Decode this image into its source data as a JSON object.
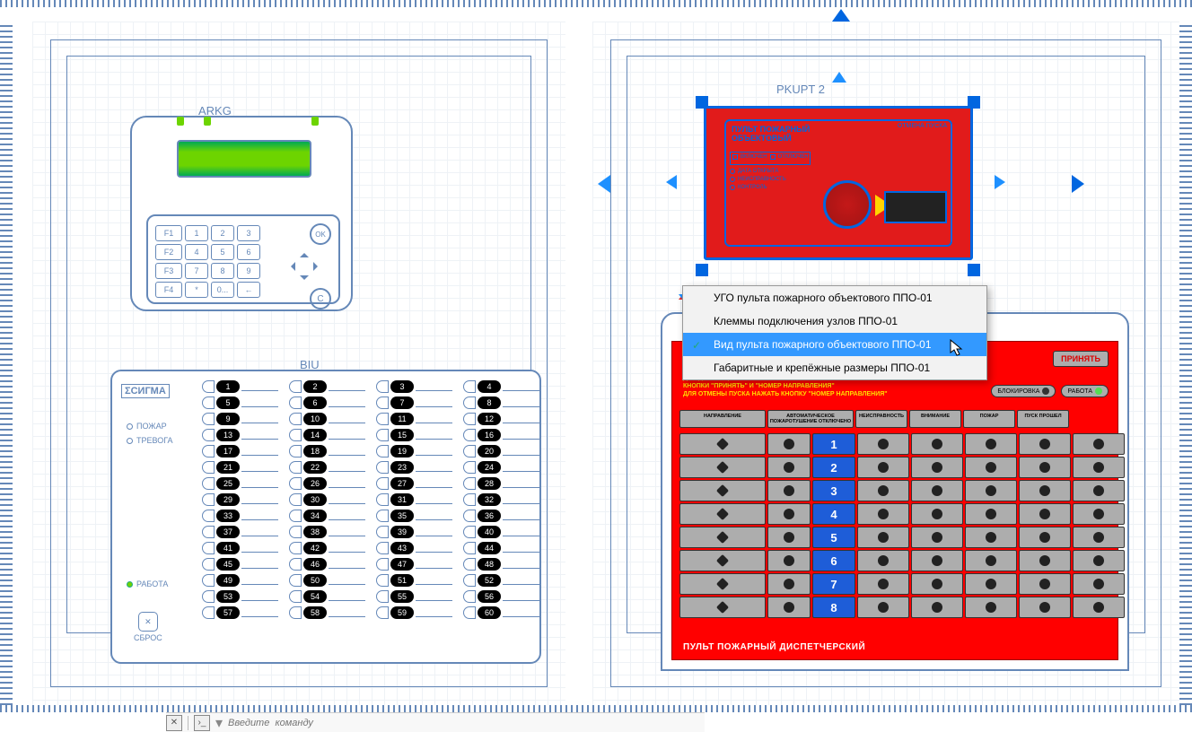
{
  "left_page": {
    "arkg": {
      "label": "ARKG",
      "function_keys": [
        "F1",
        "F2",
        "F3",
        "F4"
      ],
      "numpad": [
        [
          "1",
          "2",
          "3"
        ],
        [
          "4",
          "5",
          "6"
        ],
        [
          "7",
          "8",
          "9"
        ],
        [
          "*",
          "0...",
          "←"
        ]
      ],
      "ok": "OK",
      "c": "C"
    },
    "biu": {
      "label": "BIU",
      "brand": "ΣСИГМА",
      "status": {
        "fire": "ПОЖАР",
        "alarm": "ТРЕВОГА",
        "work": "РАБОТА"
      },
      "reset": "СБРОС",
      "zones": [
        "1",
        "2",
        "3",
        "4",
        "5",
        "6",
        "7",
        "8",
        "9",
        "10",
        "11",
        "12",
        "13",
        "14",
        "15",
        "16",
        "17",
        "18",
        "19",
        "20",
        "21",
        "22",
        "23",
        "24",
        "25",
        "26",
        "27",
        "28",
        "29",
        "30",
        "31",
        "32",
        "33",
        "34",
        "35",
        "36",
        "37",
        "38",
        "39",
        "40",
        "41",
        "42",
        "43",
        "44",
        "45",
        "46",
        "47",
        "48",
        "49",
        "50",
        "51",
        "52",
        "53",
        "54",
        "55",
        "56",
        "57",
        "58",
        "59",
        "60"
      ]
    }
  },
  "right_page": {
    "pkupt": {
      "label": "PKUPT 2",
      "ppo": {
        "title_line1": "ПУЛЬТ ПОЖАРНЫЙ",
        "title_line2": "ОБЪЕКТОВЫЙ",
        "cancel": "ОТМЕНА ПУСКА",
        "on": "ВКЛЮЧЕН",
        "off": "ОТКЛЮЧЕН"
      }
    },
    "context_menu": {
      "items": [
        "УГО пульта пожарного объектового ППО-01",
        "Клеммы подключения узлов ППО-01",
        "Вид пульта пожарного объектового ППО-01",
        "Габаритные и крепёжные размеры ППО-01"
      ],
      "selected_index": 2
    },
    "dispatcher": {
      "accept_btn": "ПРИНЯТЬ",
      "instructions": "ДЛЯ ДИСТАНЦИОННОГО ПУСКА НАЖАТЬ\nКНОПКИ \"ПРИНЯТЬ\" И \"НОМЕР НАПРАВЛЕНИЯ\"\nДЛЯ ОТМЕНЫ ПУСКА НАЖАТЬ КНОПКУ \"НОМЕР НАПРАВЛЕНИЯ\"",
      "mode_block": "БЛОКИРОВКА",
      "mode_work": "РАБОТА",
      "headers": [
        "НАПРАВЛЕНИЕ",
        "АВТОМАТИЧЕСКОЕ ПОЖАРОТУШЕНИЕ ОТКЛЮЧЕНО",
        "НЕИСПРАВНОСТЬ",
        "ВНИМАНИЕ",
        "ПОЖАР",
        "ПУСК ПРОШЕЛ"
      ],
      "row_numbers": [
        "1",
        "2",
        "3",
        "4",
        "5",
        "6",
        "7",
        "8"
      ],
      "footer": "ПУЛЬТ ПОЖАРНЫЙ ДИСПЕТЧЕРСКИЙ"
    }
  },
  "command_bar": {
    "placeholder": "Введите  команду"
  }
}
